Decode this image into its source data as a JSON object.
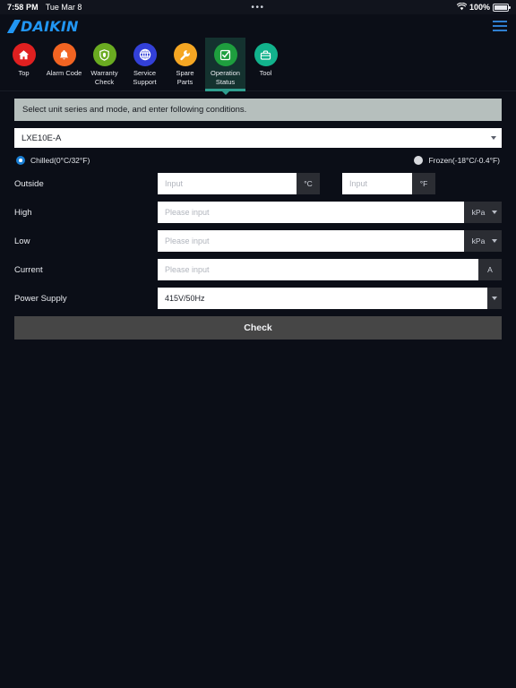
{
  "statusbar": {
    "time": "7:58 PM",
    "date": "Tue Mar 8",
    "center_dots": "•••",
    "battery_pct": "100%",
    "wifi_icon": "wifi-icon",
    "battery_icon": "battery-icon"
  },
  "brand": {
    "logo_text": "DAIKIN",
    "logo_color": "#2196f3",
    "menu_icon": "hamburger-menu-icon"
  },
  "nav": {
    "items": [
      {
        "label": "Top",
        "icon": "home-icon",
        "color": "#e02020",
        "active": false
      },
      {
        "label": "Alarm Code",
        "icon": "bell-icon",
        "color": "#f26422",
        "active": false
      },
      {
        "label": "Warranty\nCheck",
        "icon": "shield-icon",
        "color": "#6aab21",
        "active": false
      },
      {
        "label": "Service\nSupport",
        "icon": "globe-icon",
        "color": "#3340d8",
        "active": false
      },
      {
        "label": "Spare\nParts",
        "icon": "wrench-icon",
        "color": "#f5a623",
        "active": false
      },
      {
        "label": "Operation\nStatus",
        "icon": "checklist-icon",
        "color": "#1e9e3e",
        "active": true
      },
      {
        "label": "Tool",
        "icon": "toolbox-icon",
        "color": "#12b28c",
        "active": false
      }
    ],
    "active_bg": "#14322f",
    "active_accent": "#2f9e8f"
  },
  "main": {
    "banner": "Select unit series and mode, and enter following conditions.",
    "unit_series": {
      "value": "LXE10E-A"
    },
    "mode": {
      "chilled": {
        "label": "Chilled(0°C/32°F)",
        "selected": true
      },
      "frozen": {
        "label": "Frozen(-18°C/-0.4°F)",
        "selected": false
      }
    },
    "rows": [
      {
        "label": "Outside",
        "inputs": [
          {
            "placeholder": "Input",
            "value": "",
            "suffix": "°C",
            "suffix_caret": false
          },
          {
            "placeholder": "Input",
            "value": "",
            "suffix": "°F",
            "suffix_caret": false
          }
        ]
      },
      {
        "label": "High",
        "inputs": [
          {
            "placeholder": "Please input",
            "value": "",
            "suffix": "kPa",
            "suffix_caret": true
          }
        ]
      },
      {
        "label": "Low",
        "inputs": [
          {
            "placeholder": "Please input",
            "value": "",
            "suffix": "kPa",
            "suffix_caret": true
          }
        ]
      },
      {
        "label": "Current",
        "inputs": [
          {
            "placeholder": "Please input",
            "value": "",
            "suffix": "A",
            "suffix_caret": false
          }
        ]
      }
    ],
    "power_supply": {
      "label": "Power Supply",
      "value": "415V/50Hz"
    },
    "check_button": "Check"
  }
}
